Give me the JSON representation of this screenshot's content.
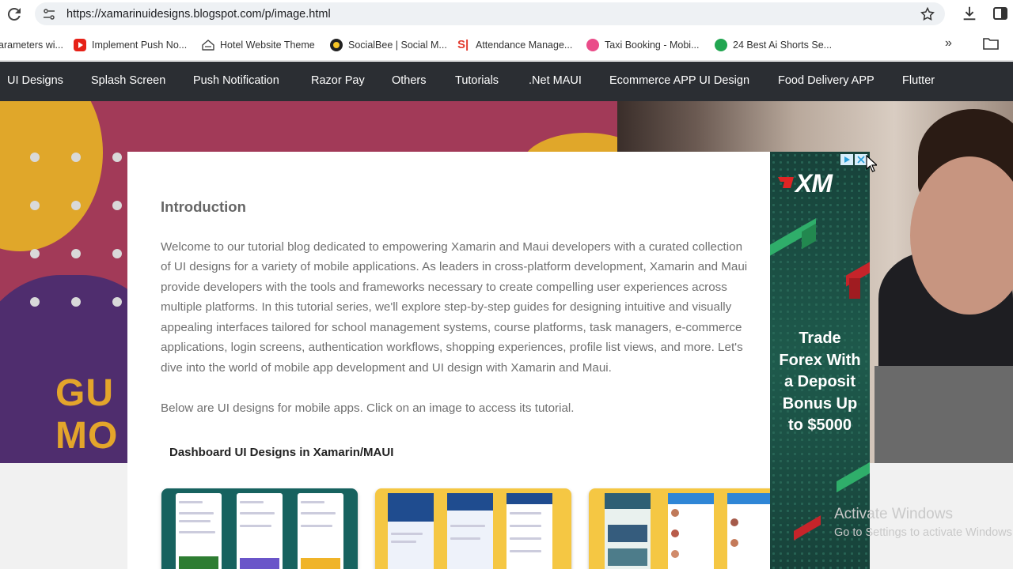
{
  "browser": {
    "url": "https://xamarinuidesigns.blogspot.com/p/image.html",
    "bookmarks": [
      {
        "label": "arameters wi...",
        "icon": "none"
      },
      {
        "label": "Implement Push No...",
        "icon": "youtube-icon"
      },
      {
        "label": "Hotel Website Theme",
        "icon": "hotel-icon"
      },
      {
        "label": "SocialBee | Social M...",
        "icon": "socialbee-icon"
      },
      {
        "label": "Attendance Manage...",
        "icon": "si-icon"
      },
      {
        "label": "Taxi Booking - Mobi...",
        "icon": "dribbble-icon"
      },
      {
        "label": "24 Best Ai Shorts Se...",
        "icon": "green-leaf-icon"
      }
    ]
  },
  "nav": {
    "items": [
      "UI Designs",
      "Splash Screen",
      "Push Notification",
      "Razor Pay",
      "Others",
      "Tutorials",
      ".Net MAUI",
      "Ecommerce APP UI Design",
      "Food Delivery APP",
      "Flutter"
    ]
  },
  "hero": {
    "text_line1": "GU",
    "text_line2": "MO"
  },
  "content": {
    "intro_title": "Introduction",
    "intro_lines": [
      "Welcome to our tutorial blog dedicated to empowering Xamarin and Maui developers with a curated collection",
      "of UI designs for a variety of mobile applications. As leaders in cross-platform development, Xamarin and Maui",
      "provide developers with the tools and frameworks necessary to create compelling user experiences across",
      "multiple platforms. In this tutorial series, we'll explore step-by-step guides for designing intuitive and visually",
      "appealing interfaces tailored for school management systems, course platforms, task managers, e-commerce",
      "applications, login screens, authentication workflows, shopping experiences, profile list views, and more. Let's",
      "dive into the world of mobile app development and UI design with Xamarin and Maui."
    ],
    "below_text": "Below are UI designs for mobile apps. Click on an image to access its tutorial.",
    "section_title": "Dashboard UI Designs in Xamarin/MAUI"
  },
  "ad": {
    "brand": "XM",
    "lines": [
      "Trade",
      "Forex With",
      "a Deposit",
      "Bonus Up",
      "to $5000"
    ]
  },
  "watermark": {
    "line1": "Activate Windows",
    "line2": "Go to Settings to activate Windows."
  },
  "colors": {
    "nav_bg": "#2b2e33",
    "hero_bg": "#a23a58",
    "accent_yellow": "#e0a72a",
    "ad_green": "#1e5a4c"
  }
}
